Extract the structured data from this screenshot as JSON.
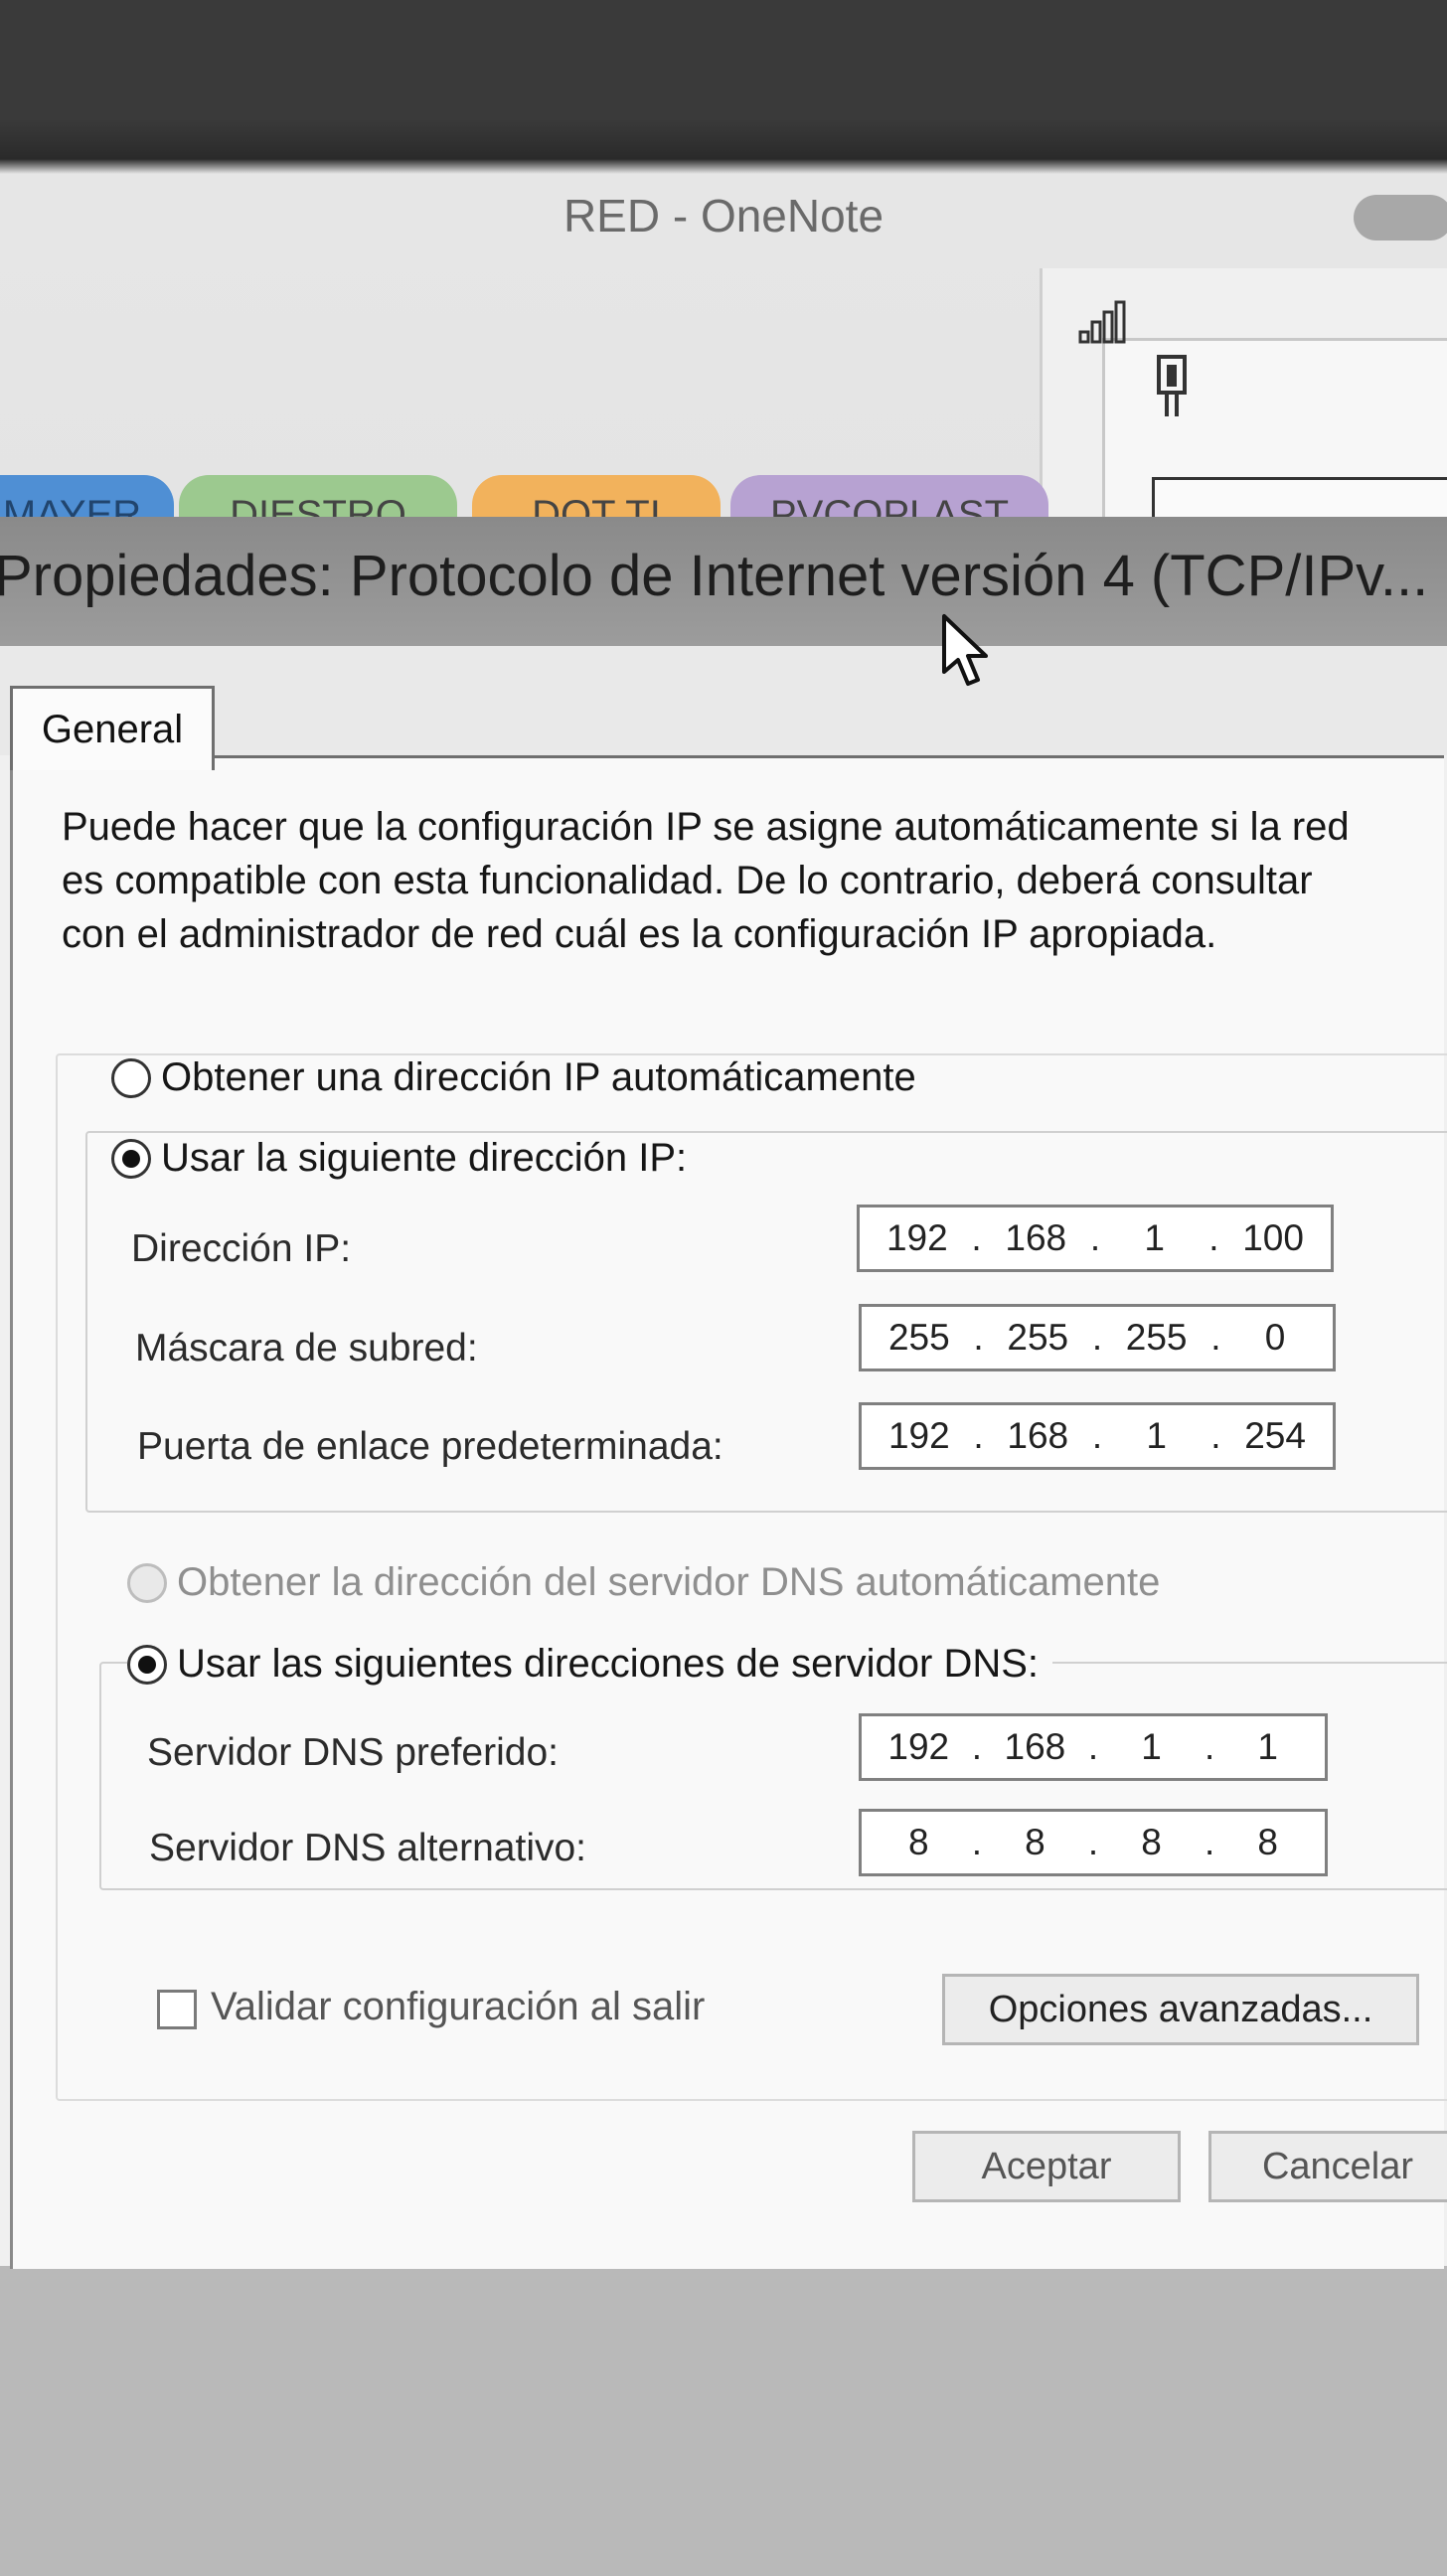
{
  "background_app": {
    "title": "RED - OneNote",
    "section_tabs": [
      "MAYER",
      "DIESTRO",
      "DOT TI",
      "PVCOPLAST"
    ]
  },
  "dialog": {
    "title": "Propiedades: Protocolo de Internet versión 4 (TCP/IPv...",
    "tabs": [
      "General"
    ],
    "description": "Puede hacer que la configuración IP se asigne automáticamente si la red es compatible con esta funcionalidad. De lo contrario, deberá consultar con el administrador de red cuál es la configuración IP apropiada.",
    "ip": {
      "auto_label": "Obtener una dirección IP automáticamente",
      "manual_label": "Usar la siguiente dirección IP:",
      "selected": "manual",
      "fields": [
        {
          "label": "Dirección IP:",
          "octets": [
            "192",
            "168",
            "1",
            "100"
          ]
        },
        {
          "label": "Máscara de subred:",
          "octets": [
            "255",
            "255",
            "255",
            "0"
          ]
        },
        {
          "label": "Puerta de enlace predeterminada:",
          "octets": [
            "192",
            "168",
            "1",
            "254"
          ]
        }
      ]
    },
    "dns": {
      "auto_label": "Obtener la dirección del servidor DNS automáticamente",
      "manual_label": "Usar las siguientes direcciones de servidor DNS:",
      "selected": "manual",
      "fields": [
        {
          "label": "Servidor DNS preferido:",
          "octets": [
            "192",
            "168",
            "1",
            "1"
          ]
        },
        {
          "label": "Servidor DNS alternativo:",
          "octets": [
            "8",
            "8",
            "8",
            "8"
          ]
        }
      ]
    },
    "validate_label": "Validar configuración al salir",
    "validate_checked": false,
    "advanced_button": "Opciones avanzadas...",
    "ok_button": "Aceptar",
    "cancel_button": "Cancelar"
  }
}
